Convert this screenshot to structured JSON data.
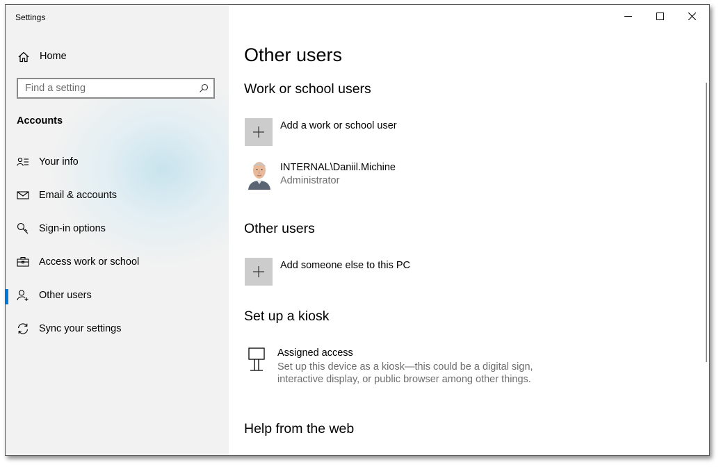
{
  "window": {
    "title": "Settings",
    "controls": [
      "minimize",
      "maximize",
      "close"
    ]
  },
  "sidebar": {
    "home_label": "Home",
    "search_placeholder": "Find a setting",
    "section_title": "Accounts",
    "items": [
      {
        "label": "Your info",
        "icon": "person-list-icon",
        "selected": false
      },
      {
        "label": "Email & accounts",
        "icon": "mail-icon",
        "selected": false
      },
      {
        "label": "Sign-in options",
        "icon": "key-icon",
        "selected": false
      },
      {
        "label": "Access work or school",
        "icon": "briefcase-icon",
        "selected": false
      },
      {
        "label": "Other users",
        "icon": "person-add-icon",
        "selected": true
      },
      {
        "label": "Sync your settings",
        "icon": "sync-icon",
        "selected": false
      }
    ]
  },
  "main": {
    "page_title": "Other users",
    "work_school": {
      "heading": "Work or school users",
      "add_label": "Add a work or school user",
      "user": {
        "name": "INTERNAL\\Daniil.Michine",
        "role": "Administrator"
      }
    },
    "other_users": {
      "heading": "Other users",
      "add_label": "Add someone else to this PC"
    },
    "kiosk": {
      "heading": "Set up a kiosk",
      "title": "Assigned access",
      "desc_line1": "Set up this device as a kiosk—this could be a digital sign,",
      "desc_line2": "interactive display, or public browser among other things."
    },
    "help": {
      "heading": "Help from the web"
    }
  },
  "colors": {
    "accent": "#0078d7",
    "sidebar_bg": "#f2f2f2",
    "tile_bg": "#cccccc",
    "secondary_text": "#6d6d6d"
  }
}
